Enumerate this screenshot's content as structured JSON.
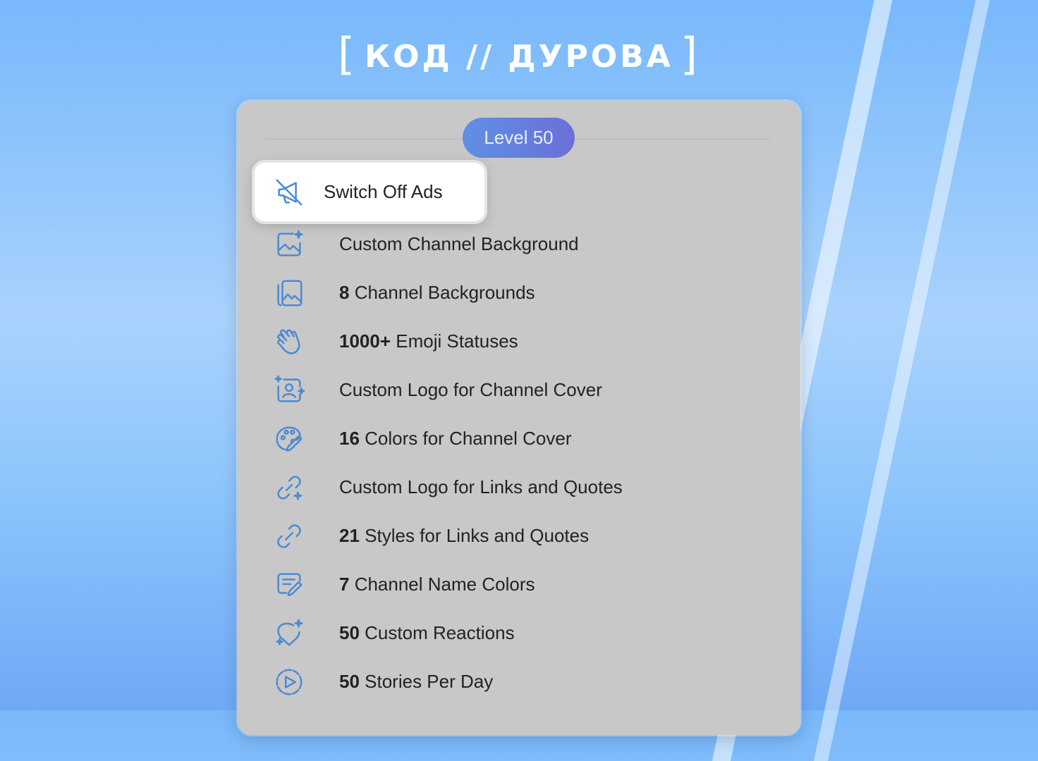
{
  "brand": {
    "open_bracket": "[",
    "text": "КОД // ДУРОВА",
    "close_bracket": "]"
  },
  "level_badge": "Level 50",
  "accent_color": "#4a8ad4",
  "features": [
    {
      "icon": "ads-off-icon",
      "prefix": "",
      "label": "Switch Off Ads"
    },
    {
      "icon": "image-sparkle-icon",
      "prefix": "",
      "label": "Custom Channel Background"
    },
    {
      "icon": "image-stack-icon",
      "prefix": "8",
      "label": " Channel Backgrounds"
    },
    {
      "icon": "wave-hand-icon",
      "prefix": "1000+",
      "label": " Emoji Statuses"
    },
    {
      "icon": "user-sparkle-icon",
      "prefix": "",
      "label": "Custom Logo for Channel Cover"
    },
    {
      "icon": "palette-icon",
      "prefix": "16",
      "label": " Colors for Channel Cover"
    },
    {
      "icon": "link-sparkle-icon",
      "prefix": "",
      "label": "Custom Logo for Links and Quotes"
    },
    {
      "icon": "link-icon",
      "prefix": "21",
      "label": " Styles for Links and Quotes"
    },
    {
      "icon": "edit-lines-icon",
      "prefix": "7",
      "label": " Channel Name Colors"
    },
    {
      "icon": "heart-sparkle-icon",
      "prefix": "50",
      "label": " Custom Reactions"
    },
    {
      "icon": "play-circle-icon",
      "prefix": "50",
      "label": " Stories Per Day"
    }
  ]
}
